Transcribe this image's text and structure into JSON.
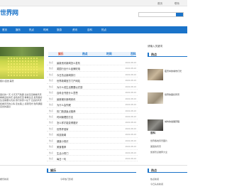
{
  "topbar": {
    "home": "首页",
    "about": "联系"
  },
  "logo": "世界网",
  "nav": [
    "首页",
    "娱乐",
    "热点",
    "时间",
    "旅游",
    "资讯",
    "百科",
    "热点"
  ],
  "hero_caption": "照片/自然 美景",
  "intro": "美好的一天 今天天气晴朗 出去走走看看风景 看看远处的花 金色的花田 看看生活 发现美好 生活需要仪式感 旅行的意义在于 沿途的风景 和看风景的心情 走在路上 感受阳光 微风拂面 自然的美好",
  "tabs": [
    "娱乐",
    "热点",
    "时间",
    "百科"
  ],
  "rows": [
    {
      "tag": "热点",
      "title": "最新资讯新闻怎么发布",
      "date": "2022-08-16"
    },
    {
      "tag": "热点",
      "title": "英国行业什么品牌好用",
      "date": "2022-08-16"
    },
    {
      "tag": "热点",
      "title": "今日热点新闻排行",
      "date": "2022-08-16"
    },
    {
      "tag": "热点",
      "title": "世界新闻官方门户网站",
      "date": "2022-08-16"
    },
    {
      "tag": "热点",
      "title": "为什么说生活需要仪式感",
      "date": "2022-08-16"
    },
    {
      "tag": "热点",
      "title": "百科全书是什么意思",
      "date": "2022-08-16"
    },
    {
      "tag": "热点",
      "title": "最新娱乐新闻资讯",
      "date": "2022-08-16"
    },
    {
      "tag": "热点",
      "title": "为什么会失眠",
      "date": "2022-08-16"
    },
    {
      "tag": "热点",
      "title": "热门旅游景点推荐",
      "date": "2022-08-16"
    },
    {
      "tag": "热点",
      "title": "时间管理的方法",
      "date": "2022-08-16"
    },
    {
      "tag": "热点",
      "title": "怎么样才能变得更好",
      "date": "2022-08-16"
    },
    {
      "tag": "热点",
      "title": "世界杯冠军",
      "date": "2022-08-16"
    },
    {
      "tag": "热点",
      "title": "科技新闻",
      "date": "2022-08-16"
    },
    {
      "tag": "热点",
      "title": "健康小常识",
      "date": "2022-08-16"
    },
    {
      "tag": "热点",
      "title": "美食推荐",
      "date": "2022-08-16"
    },
    {
      "tag": "热点",
      "title": "生活小窍门",
      "date": "2022-08-16"
    },
    {
      "tag": "热点",
      "title": "每日一句",
      "date": "2022-08-16"
    }
  ],
  "right": {
    "label": "请输入关键词",
    "head": "热点",
    "thumb1": "夜景中的城市灯光",
    "thumb2": "世界的美好风景",
    "thumb3": "城市的发展历程",
    "section": "百科",
    "items": [
      "世界各地风景图片",
      "美丽的风景",
      "旅游景点推荐大全"
    ]
  },
  "bottom": {
    "left_head": "娱乐",
    "mid_head": "热点",
    "items": [
      "娱乐新闻",
      "今年热门影视",
      "热点新闻",
      "今日头条新闻"
    ]
  }
}
